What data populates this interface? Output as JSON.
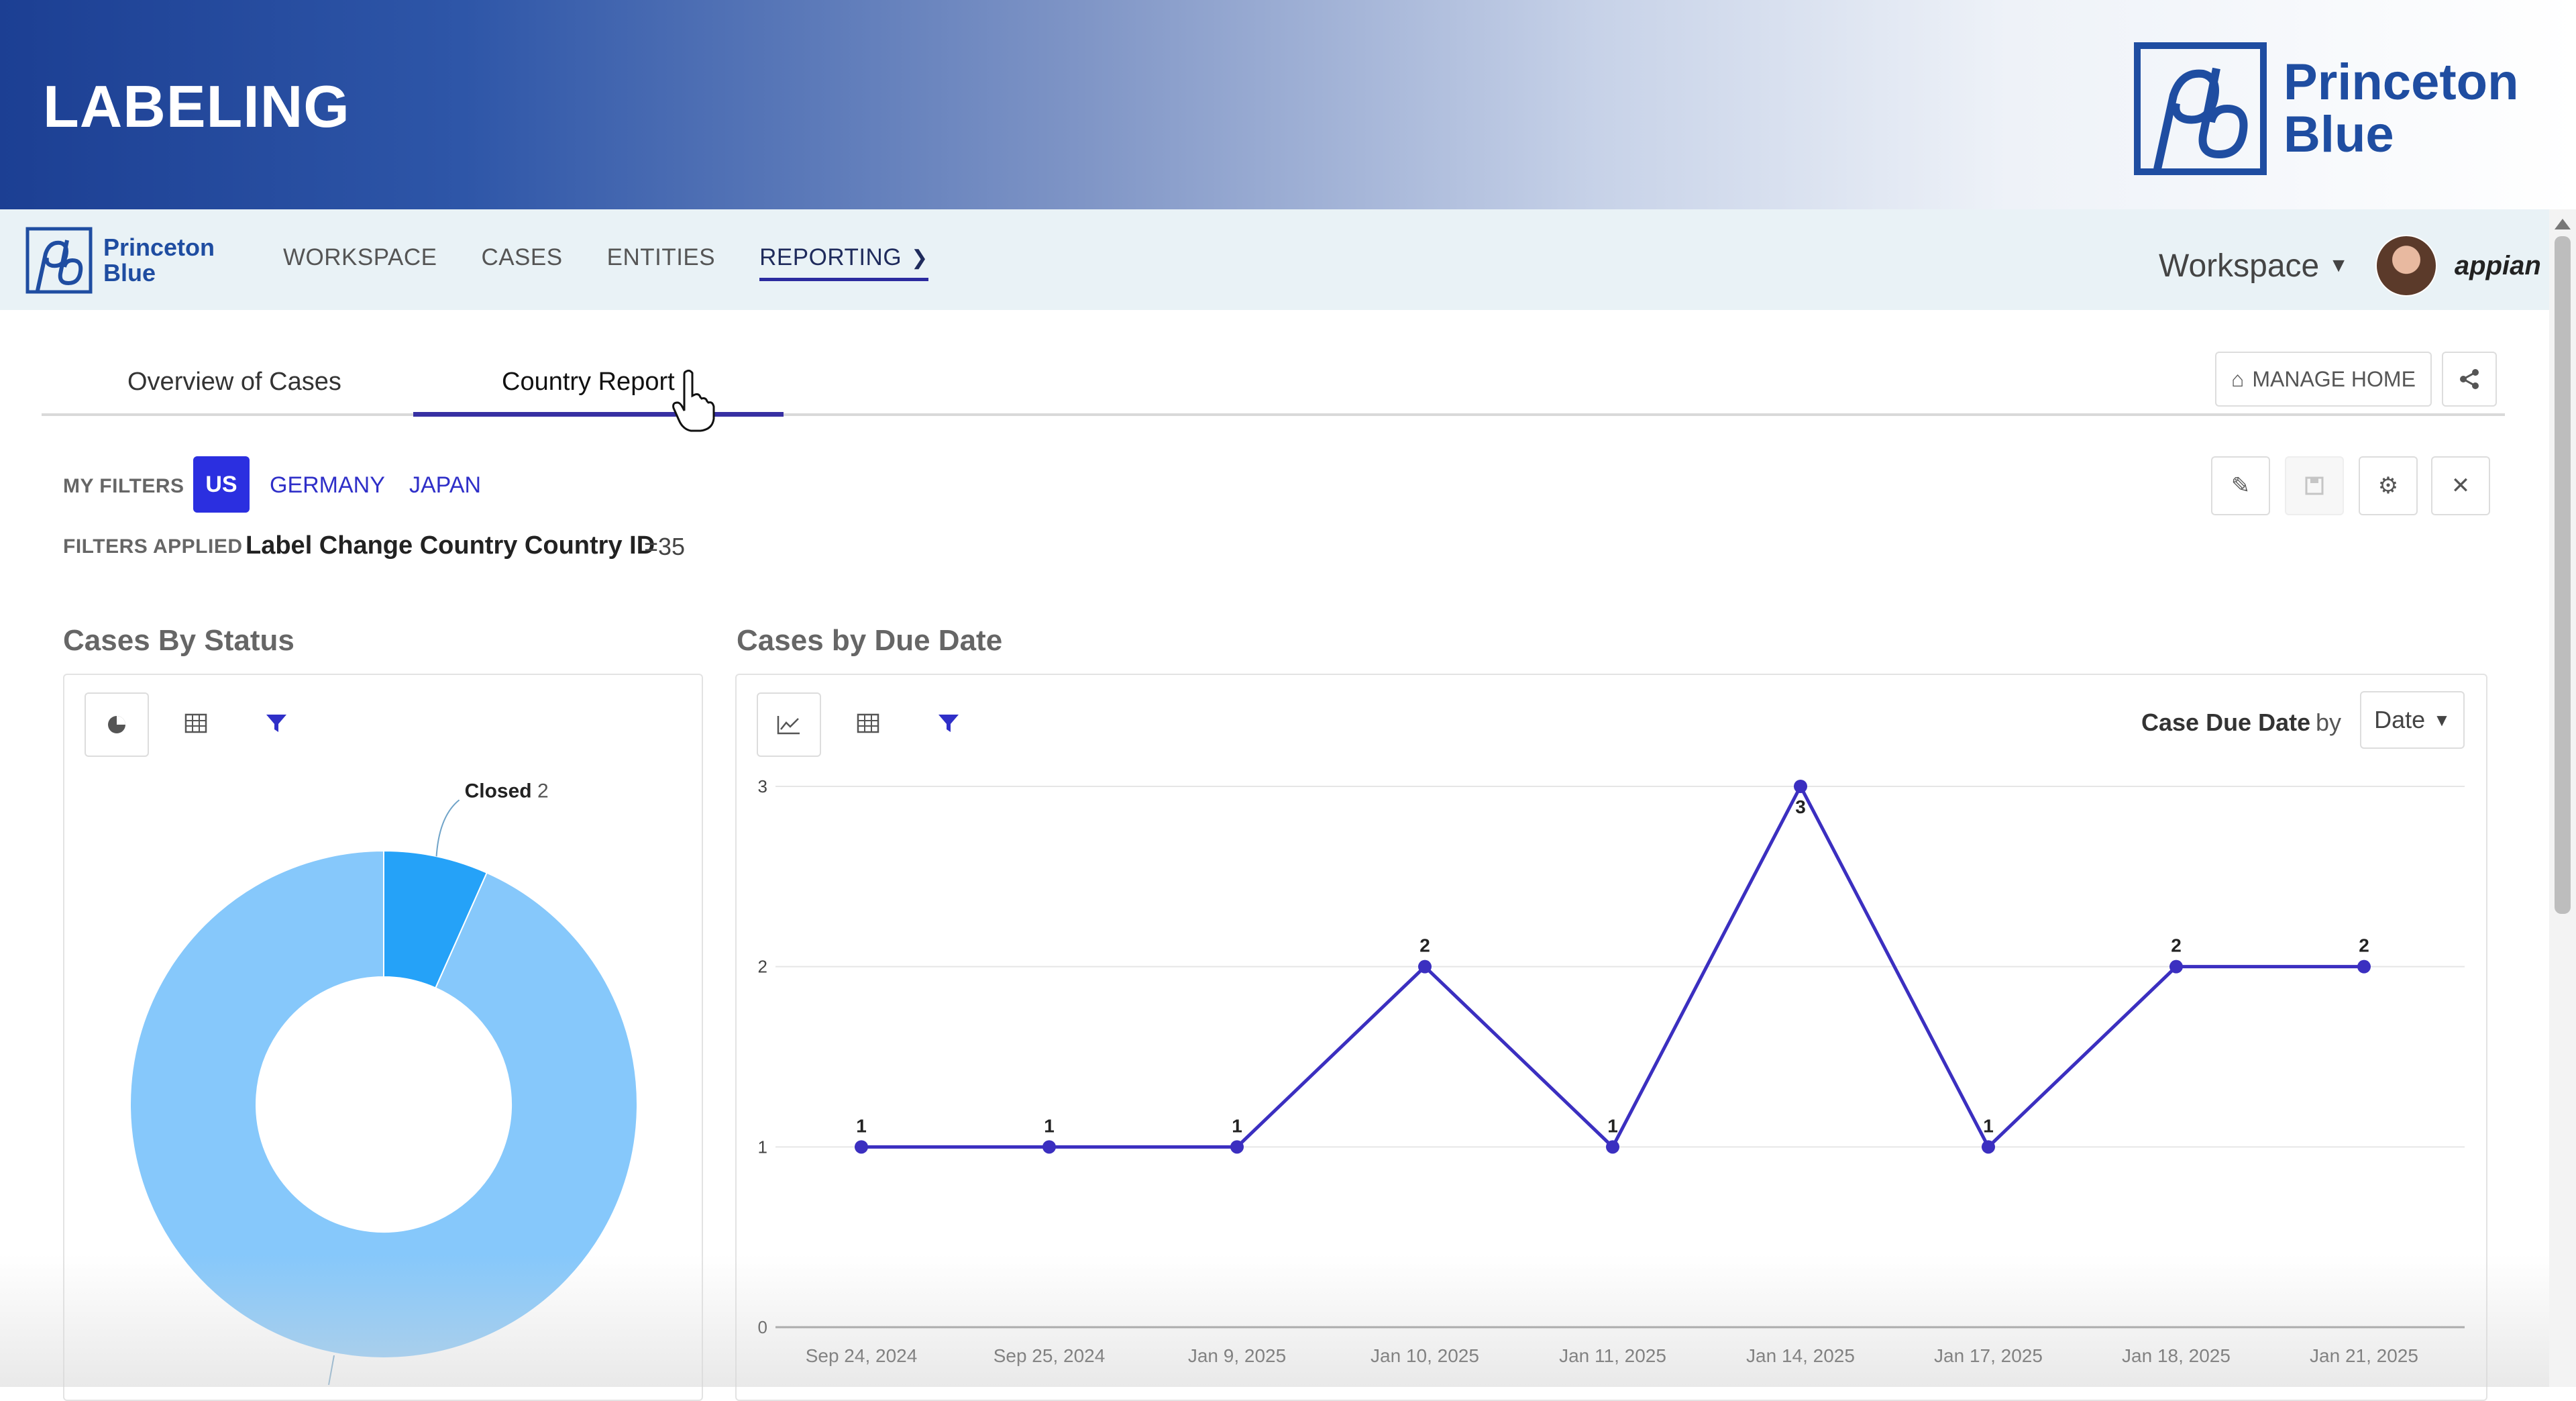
{
  "banner": {
    "title": "LABELING",
    "logo_text_line1": "Princeton",
    "logo_text_line2": "Blue"
  },
  "navbar": {
    "logo_text_line1": "Princeton",
    "logo_text_line2": "Blue",
    "items": [
      {
        "label": "WORKSPACE"
      },
      {
        "label": "CASES"
      },
      {
        "label": "ENTITIES"
      },
      {
        "label": "REPORTING"
      }
    ],
    "workspace_label": "Workspace",
    "brand": "appian"
  },
  "tabs": [
    {
      "label": "Overview of Cases",
      "active": false
    },
    {
      "label": "Country Report",
      "active": true
    }
  ],
  "actions": {
    "manage_home": "MANAGE HOME"
  },
  "filters": {
    "my_filters_label": "MY FILTERS",
    "chips": [
      "US",
      "GERMANY",
      "JAPAN"
    ],
    "selected": "US",
    "applied_label": "FILTERS APPLIED",
    "applied_name": "Label Change Country Country ID",
    "applied_value": "=35"
  },
  "cases_by_status": {
    "title": "Cases By Status",
    "callout_label": "Closed",
    "callout_value": "2"
  },
  "cases_by_due_date": {
    "title": "Cases by Due Date",
    "group_label": "Case Due Date",
    "group_by_word": "by",
    "group_by_value": "Date"
  },
  "colors": {
    "accent": "#3730a3",
    "chip_selected": "#2b2fe0",
    "line": "#3b2fc0",
    "pie_main": "#86c8fb",
    "pie_closed": "#25a2f8"
  },
  "chart_data": [
    {
      "type": "pie",
      "title": "Cases By Status",
      "donut": true,
      "slices": [
        {
          "label": "Closed",
          "value": 2,
          "color": "#25a2f8"
        },
        {
          "label": "",
          "value": 28,
          "color": "#86c8fb"
        }
      ]
    },
    {
      "type": "line",
      "title": "Cases by Due Date",
      "categories": [
        "Sep 24, 2024",
        "Sep 25, 2024",
        "Jan 9, 2025",
        "Jan 10, 2025",
        "Jan 11, 2025",
        "Jan 14, 2025",
        "Jan 17, 2025",
        "Jan 18, 2025",
        "Jan 21, 2025"
      ],
      "values": [
        1,
        1,
        1,
        2,
        1,
        3,
        1,
        2,
        2
      ],
      "ylim": [
        0,
        3
      ],
      "yticks": [
        0,
        1,
        2,
        3
      ],
      "grid": true
    }
  ]
}
